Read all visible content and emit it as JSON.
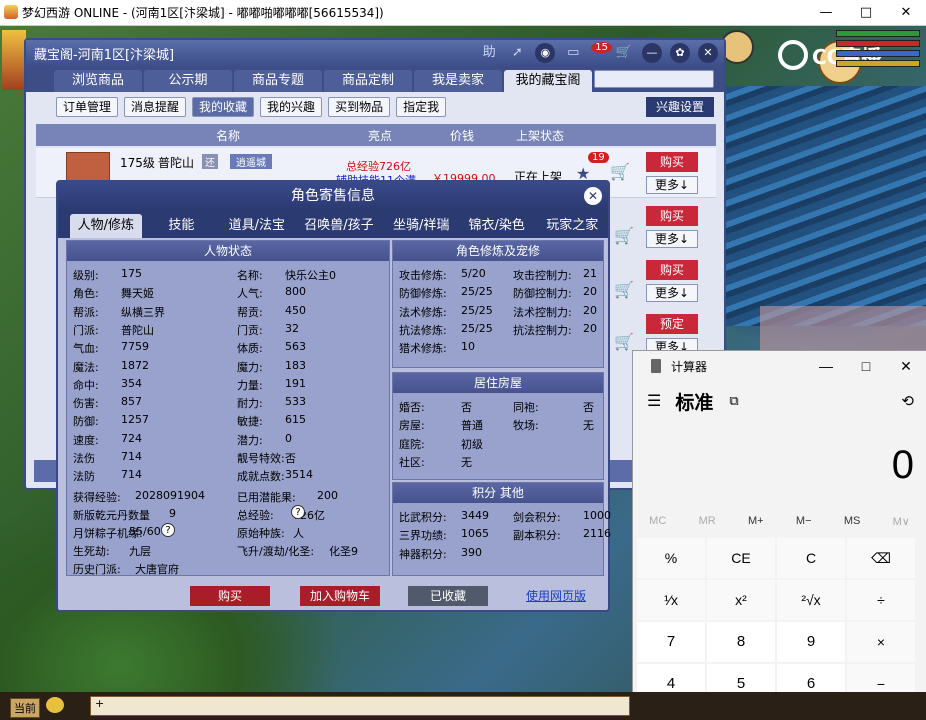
{
  "window": {
    "title": "梦幻西游 ONLINE - (河南1区[汴梁城] - 嘟嘟啪嘟嘟嘟[56615534])",
    "controls": [
      "—",
      "□",
      "✕"
    ]
  },
  "hud": {
    "logo_text": "CC直播",
    "bar_colors": [
      "#2a9a3a",
      "#c82828",
      "#3a68c8",
      "#c8a828"
    ]
  },
  "shop": {
    "title": "藏宝阁-河南1区[汴梁城]",
    "help": "助",
    "cart_badge": "15",
    "tabs": [
      "浏览商品",
      "公示期",
      "商品专题",
      "商品定制",
      "我是卖家",
      "我的藏宝阁"
    ],
    "subtabs": [
      "订单管理",
      "消息提醒",
      "我的收藏",
      "我的兴趣",
      "买到物品",
      "指定我"
    ],
    "pref_button": "兴趣设置",
    "columns": [
      "名称",
      "亮点",
      "价钱",
      "上架状态"
    ],
    "row": {
      "level": "175级",
      "school": "普陀山",
      "tag": "还",
      "server": "逍遥城",
      "hl1": "总经验726亿",
      "hl2": "辅助技能11个满",
      "price": "￥19999.00",
      "status": "正在上架",
      "fav_count": "19"
    },
    "buy_buttons": [
      "购买",
      "购买",
      "购买",
      "预定"
    ],
    "more_buttons": [
      "更多↓",
      "更多↓",
      "更多↓",
      "更多↓"
    ]
  },
  "role": {
    "title": "角色寄售信息",
    "close": "✕",
    "tabs": [
      "人物/修炼",
      "技能",
      "道具/法宝",
      "召唤兽/孩子",
      "坐骑/祥瑞",
      "锦衣/染色",
      "玩家之家"
    ],
    "status_header": "人物状态",
    "left": [
      {
        "k": "级别:",
        "v": "175"
      },
      {
        "k": "角色:",
        "v": "舞天姬"
      },
      {
        "k": "帮派:",
        "v": "纵横三界"
      },
      {
        "k": "门派:",
        "v": "普陀山"
      },
      {
        "k": "气血:",
        "v": "7759"
      },
      {
        "k": "魔法:",
        "v": "1872"
      },
      {
        "k": "命中:",
        "v": "354"
      },
      {
        "k": "伤害:",
        "v": "857"
      },
      {
        "k": "防御:",
        "v": "1257"
      },
      {
        "k": "速度:",
        "v": "724"
      },
      {
        "k": "法伤",
        "v": "714"
      },
      {
        "k": "法防",
        "v": "714"
      }
    ],
    "mid": [
      {
        "k": "名称:",
        "v": "快乐公主0"
      },
      {
        "k": "人气:",
        "v": "800"
      },
      {
        "k": "帮贡:",
        "v": "450"
      },
      {
        "k": "门贡:",
        "v": "32"
      },
      {
        "k": "体质:",
        "v": "563"
      },
      {
        "k": "魔力:",
        "v": "183"
      },
      {
        "k": "力量:",
        "v": "191"
      },
      {
        "k": "耐力:",
        "v": "533"
      },
      {
        "k": "敏捷:",
        "v": "615"
      },
      {
        "k": "潜力:",
        "v": "0"
      },
      {
        "k": "靓号特效:",
        "v": "否"
      },
      {
        "k": "成就点数:",
        "v": "3514"
      }
    ],
    "extra": [
      {
        "k": "获得经验:",
        "v": "2028091904"
      },
      {
        "k": "已用潜能果:",
        "v": "200"
      },
      {
        "k": "新版乾元丹数量",
        "v": "9"
      },
      {
        "k": "总经验:",
        "v": "726亿"
      },
      {
        "k": "月饼粽子机缘:",
        "v": "55/60"
      },
      {
        "k": "原始种族:",
        "v": "人"
      },
      {
        "k": "生死劫:",
        "v": "九层"
      },
      {
        "k": "飞升/渡劫/化圣:",
        "v": "化圣9"
      },
      {
        "k": "历史门派:",
        "v": "大唐官府"
      }
    ],
    "cult_header": "角色修炼及宠修",
    "cult": [
      {
        "k": "攻击修炼:",
        "v": "5/20",
        "k2": "攻击控制力:",
        "v2": "21"
      },
      {
        "k": "防御修炼:",
        "v": "25/25",
        "k2": "防御控制力:",
        "v2": "20"
      },
      {
        "k": "法术修炼:",
        "v": "25/25",
        "k2": "法术控制力:",
        "v2": "20"
      },
      {
        "k": "抗法修炼:",
        "v": "25/25",
        "k2": "抗法控制力:",
        "v2": "20"
      },
      {
        "k": "猎术修炼:",
        "v": "10",
        "k2": "",
        "v2": ""
      }
    ],
    "house_header": "居住房屋",
    "house": [
      {
        "k": "婚否:",
        "v": "否",
        "k2": "同袍:",
        "v2": "否"
      },
      {
        "k": "房屋:",
        "v": "普通",
        "k2": "牧场:",
        "v2": "无"
      },
      {
        "k": "庭院:",
        "v": "初级",
        "k2": "",
        "v2": ""
      },
      {
        "k": "社区:",
        "v": "无",
        "k2": "",
        "v2": ""
      }
    ],
    "score_header": "积分 其他",
    "score": [
      {
        "k": "比武积分:",
        "v": "3449",
        "k2": "剑会积分:",
        "v2": "1000"
      },
      {
        "k": "三界功绩:",
        "v": "1065",
        "k2": "副本积分:",
        "v2": "2116"
      },
      {
        "k": "神器积分:",
        "v": "390",
        "k2": "",
        "v2": ""
      }
    ],
    "btn_buy": "购买",
    "btn_cart": "加入购物车",
    "btn_fav": "已收藏",
    "btn_web": "使用网页版"
  },
  "calc": {
    "title": "计算器",
    "mode": "标准",
    "display": "0",
    "controls": [
      "—",
      "□",
      "✕"
    ],
    "memory": [
      "MC",
      "MR",
      "M+",
      "M−",
      "MS",
      "M∨"
    ],
    "keys": [
      "%",
      "CE",
      "C",
      "⌫",
      "¹⁄x",
      "x²",
      "²√x",
      "÷",
      "7",
      "8",
      "9",
      "×",
      "4",
      "5",
      "6",
      "−"
    ]
  },
  "bottom": {
    "label": "当前",
    "chat": "+"
  }
}
